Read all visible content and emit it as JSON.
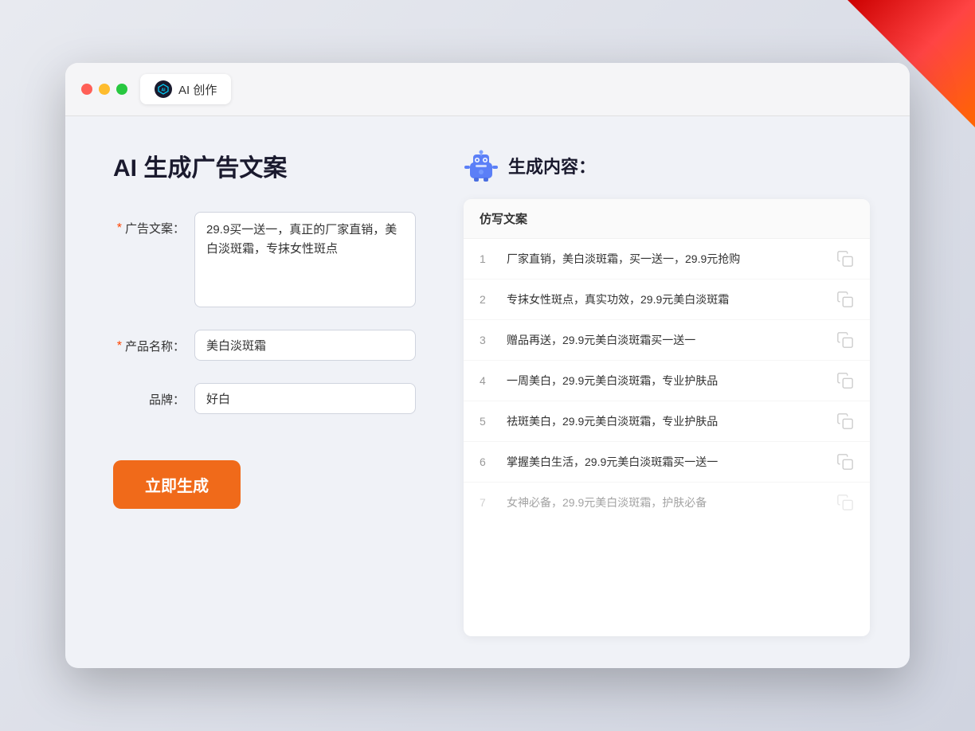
{
  "window": {
    "tab_icon_text": "AI",
    "tab_label": "AI 创作"
  },
  "left_panel": {
    "page_title": "AI 生成广告文案",
    "form": {
      "ad_copy": {
        "label": "广告文案：",
        "required": true,
        "value": "29.9买一送一，真正的厂家直销，美白淡斑霜，专抹女性斑点"
      },
      "product_name": {
        "label": "产品名称：",
        "required": true,
        "value": "美白淡斑霜"
      },
      "brand": {
        "label": "品牌：",
        "required": false,
        "value": "好白"
      }
    },
    "generate_button": "立即生成"
  },
  "right_panel": {
    "result_title": "生成内容：",
    "table_header": "仿写文案",
    "results": [
      {
        "id": 1,
        "text": "厂家直销，美白淡斑霜，买一送一，29.9元抢购",
        "dimmed": false
      },
      {
        "id": 2,
        "text": "专抹女性斑点，真实功效，29.9元美白淡斑霜",
        "dimmed": false
      },
      {
        "id": 3,
        "text": "赠品再送，29.9元美白淡斑霜买一送一",
        "dimmed": false
      },
      {
        "id": 4,
        "text": "一周美白，29.9元美白淡斑霜，专业护肤品",
        "dimmed": false
      },
      {
        "id": 5,
        "text": "祛斑美白，29.9元美白淡斑霜，专业护肤品",
        "dimmed": false
      },
      {
        "id": 6,
        "text": "掌握美白生活，29.9元美白淡斑霜买一送一",
        "dimmed": false
      },
      {
        "id": 7,
        "text": "女神必备，29.9元美白淡斑霜，护肤必备",
        "dimmed": true
      }
    ]
  },
  "colors": {
    "accent_orange": "#f06a1a",
    "required_red": "#ff4400",
    "text_dark": "#1a1a2e",
    "text_gray": "#999999"
  }
}
